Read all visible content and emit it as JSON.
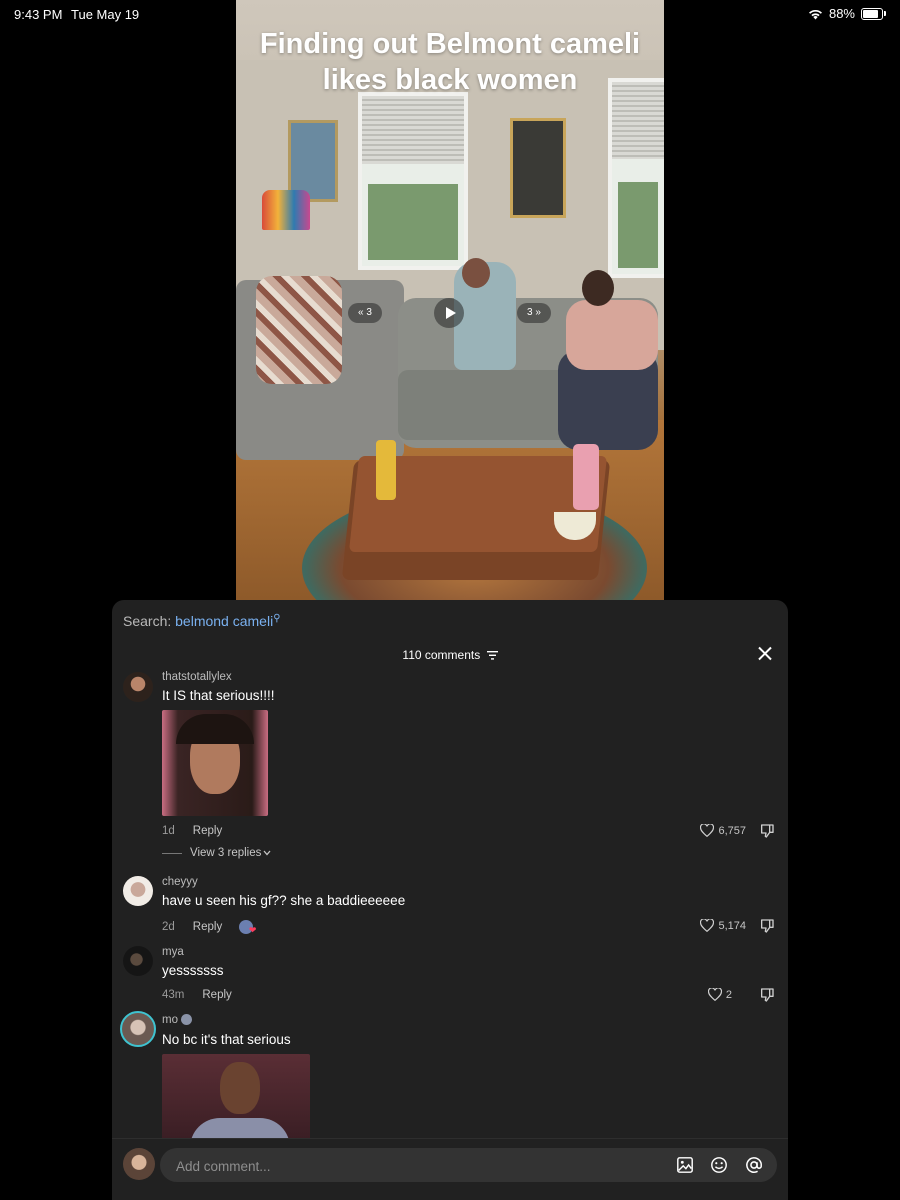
{
  "status_bar": {
    "time": "9:43 PM",
    "date": "Tue May 19",
    "battery": "88%",
    "icons": [
      "wifi-icon",
      "battery-icon"
    ]
  },
  "video": {
    "caption": "Finding out Belmont cameli likes black women",
    "prev_label": "« 3",
    "next_label": "3 »"
  },
  "comments_panel": {
    "search_prefix": "Search:",
    "search_term": "belmond cameli",
    "comment_count": "110 comments",
    "accent_color": "#7ab1f0",
    "comments": [
      {
        "username": "thatstotallylex",
        "text": "It IS that serious!!!!",
        "time": "1d",
        "reply_label": "Reply",
        "likes": "6,757",
        "view_replies": "View 3 replies"
      },
      {
        "username": "cheyyy",
        "text": "have u seen his gf?? she a baddieeeeee",
        "time": "2d",
        "reply_label": "Reply",
        "likes": "5,174"
      },
      {
        "username": "mya",
        "text": "yesssssss",
        "time": "43m",
        "reply_label": "Reply",
        "likes": "2"
      },
      {
        "username": "mo",
        "text": "No bc it's that serious"
      }
    ],
    "input": {
      "placeholder": "Add comment..."
    }
  }
}
